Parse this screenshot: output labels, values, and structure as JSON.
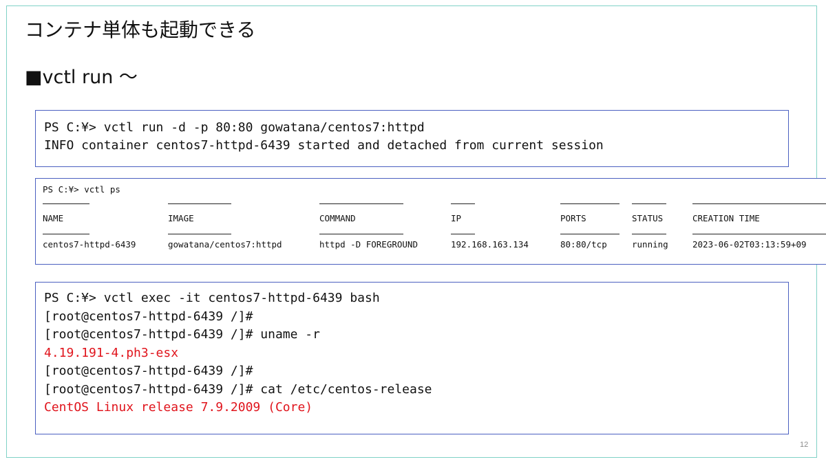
{
  "slide": {
    "title": "コンテナ単体も起動できる",
    "subtitle": "■vctl run ～",
    "page_number": "12"
  },
  "term_run": {
    "lines": [
      "PS C:¥> vctl run -d -p 80:80 gowatana/centos7:httpd",
      "INFO container centos7-httpd-6439 started and detached from current session"
    ]
  },
  "term_ps": {
    "command": "PS C:¥> vctl ps",
    "columns": [
      "NAME",
      "IMAGE",
      "COMMAND",
      "IP",
      "PORTS",
      "STATUS",
      "CREATION TIME"
    ],
    "rows": [
      [
        "centos7-httpd-6439",
        "gowatana/centos7:httpd",
        "httpd -D FOREGROUND",
        "192.168.163.134",
        "80:80/tcp",
        "running",
        "2023-06-02T03:13:59+09"
      ]
    ]
  },
  "term_exec": {
    "lines": [
      {
        "text": "PS C:¥> vctl exec -it centos7-httpd-6439 bash",
        "color": "#111111"
      },
      {
        "text": "[root@centos7-httpd-6439 /]#",
        "color": "#111111"
      },
      {
        "text": "[root@centos7-httpd-6439 /]# uname -r",
        "color": "#111111"
      },
      {
        "text": "4.19.191-4.ph3-esx",
        "color": "#e0141c"
      },
      {
        "text": "[root@centos7-httpd-6439 /]#",
        "color": "#111111"
      },
      {
        "text": "[root@centos7-httpd-6439 /]# cat /etc/centos-release",
        "color": "#111111"
      },
      {
        "text": "CentOS Linux release 7.9.2009 (Core)",
        "color": "#e0141c"
      }
    ]
  }
}
